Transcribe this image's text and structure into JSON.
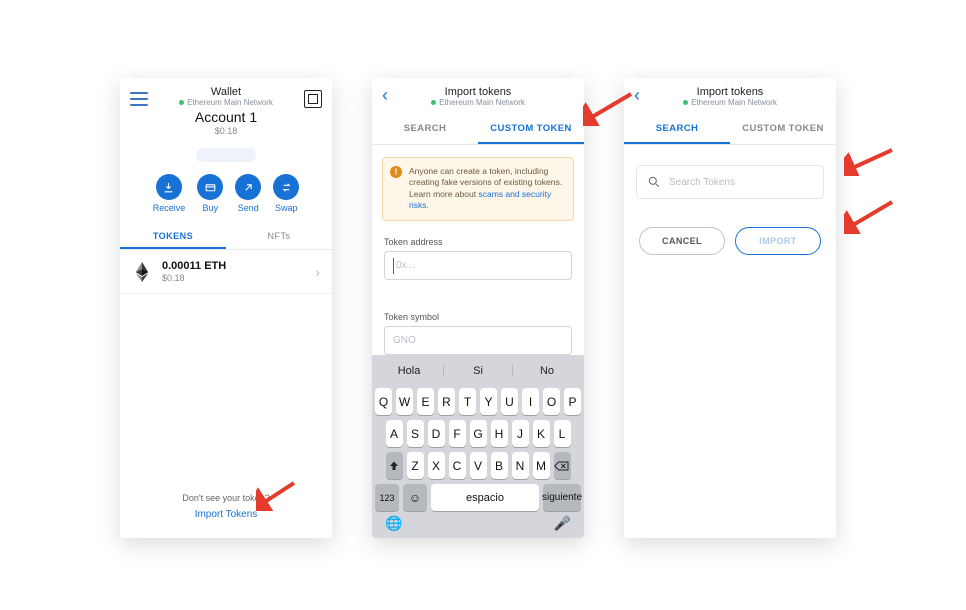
{
  "screen1": {
    "title": "Wallet",
    "network": "Ethereum Main Network",
    "account": "Account 1",
    "balance_usd": "$0.18",
    "actions": {
      "receive": "Receive",
      "buy": "Buy",
      "send": "Send",
      "swap": "Swap"
    },
    "tabs": {
      "tokens": "TOKENS",
      "nfts": "NFTs"
    },
    "asset": {
      "amount": "0.00011 ETH",
      "usd": "$0.18"
    },
    "footer_msg": "Don't see your token?",
    "footer_link": "Import Tokens"
  },
  "screen2": {
    "title": "Import tokens",
    "network": "Ethereum Main Network",
    "tabs": {
      "search": "SEARCH",
      "custom": "CUSTOM TOKEN"
    },
    "warning_a": "Anyone can create a token, including creating fake versions of existing tokens. Learn more about ",
    "warning_link": "scams and security risks.",
    "addr_label": "Token address",
    "addr_placeholder": "0x...",
    "sym_label": "Token symbol",
    "sym_placeholder": "GNO",
    "suggestions": [
      "Hola",
      "Si",
      "No"
    ],
    "row1": [
      "Q",
      "W",
      "E",
      "R",
      "T",
      "Y",
      "U",
      "I",
      "O",
      "P"
    ],
    "row2": [
      "A",
      "S",
      "D",
      "F",
      "G",
      "H",
      "J",
      "K",
      "L"
    ],
    "row3": [
      "Z",
      "X",
      "C",
      "V",
      "B",
      "N",
      "M"
    ],
    "k123": "123",
    "space": "espacio",
    "next": "siguiente"
  },
  "screen3": {
    "title": "Import tokens",
    "network": "Ethereum Main Network",
    "tabs": {
      "search": "SEARCH",
      "custom": "CUSTOM TOKEN"
    },
    "search_placeholder": "Search Tokens",
    "cancel": "CANCEL",
    "import": "IMPORT"
  }
}
